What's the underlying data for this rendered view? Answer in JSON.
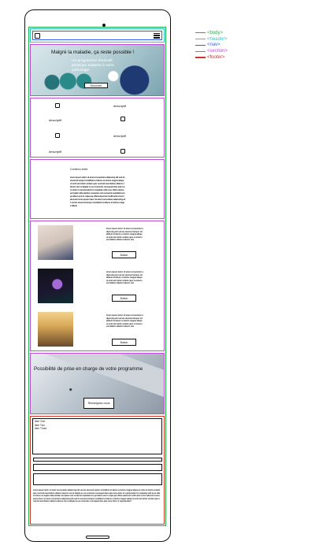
{
  "legend": [
    {
      "label": "<body>",
      "color": "#1db445"
    },
    {
      "label": "<header>",
      "color": "#2ec4c4"
    },
    {
      "label": "<nav>",
      "color": "#2a5dff"
    },
    {
      "label": "<section>",
      "color": "#c04bd6"
    },
    {
      "label": "<footer>",
      "color": "#d6332a"
    }
  ],
  "hero": {
    "title": "Malgré la maladie, ça reste possible !",
    "subtitle": "Un programme d'activité physique adaptée à votre pathologie",
    "button": "Découvrir"
  },
  "features": {
    "label": "descriptif"
  },
  "text_section": {
    "title": "Contenu texte",
    "body": "lorem ipsum dolor sit amet consectetur adipiscing elit sed do eiusmod tempor incididunt ut labore et dolore magna aliqua ut enim ad minim veniam quis nostrud exercitation ullamco laboris nisi ut aliquip ex ea commodo consequat duis aute irure dolor in reprehenderit in voluptate velit esse cillum dolore eu fugiat nulla pariatur excepteur sint occaecat cupidatat non proident sunt in culpa qui officia deserunt mollit anim id est laborum lorem ipsum dolor sit amet consectetur adipiscing elit sed do eiusmod tempor incididunt ut labore et dolore magna aliqua"
  },
  "cards": [
    {
      "body": "lorem ipsum dolor sit amet consectetur adipiscing elit sed do eiusmod tempor incididunt ut labore et dolore magna aliqua ut enim ad minim veniam quis nostrud exercitation ullamco laboris nisi",
      "button": "Button"
    },
    {
      "body": "lorem ipsum dolor sit amet consectetur adipiscing elit sed do eiusmod tempor incididunt ut labore et dolore magna aliqua ut enim ad minim veniam quis nostrud exercitation ullamco laboris nisi",
      "button": "Button"
    },
    {
      "body": "lorem ipsum dolor sit amet consectetur adipiscing elit sed do eiusmod tempor incididunt ut labore et dolore magna aliqua ut enim ad minim veniam quis nostrud exercitation ullamco laboris nisi",
      "button": "Button"
    }
  ],
  "promo": {
    "title": "Possibilité de prise en charge de votre programme",
    "button": "Renseignez-vous"
  },
  "footer": {
    "items": [
      "Item One",
      "Item Two",
      "Item Three"
    ],
    "text": "lorem ipsum dolor sit amet consectetur adipiscing elit sed do eiusmod tempor incididunt ut labore et dolore magna aliqua ut enim ad minim veniam quis nostrud exercitation ullamco laboris nisi ut aliquip ex ea commodo consequat duis aute irure dolor in reprehenderit in voluptate velit esse cillum dolore eu fugiat nulla pariatur excepteur sint occaecat cupidatat non proident sunt in culpa qui officia deserunt mollit anim id est laborum lorem ipsum dolor sit amet consectetur adipiscing elit sed do eiusmod tempor incididunt ut labore et dolore magna aliqua ut enim ad minim veniam quis nostrud exercitation ullamco laboris nisi ut aliquip ex ea commodo consequat duis aute irure dolor in reprehenderit"
  }
}
